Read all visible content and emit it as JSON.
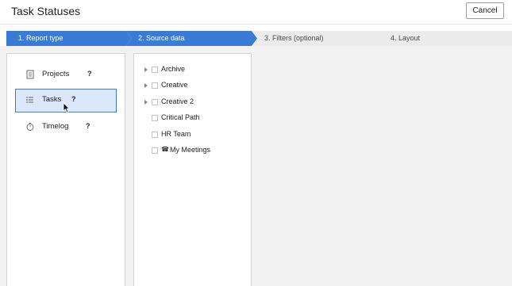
{
  "header": {
    "title": "Task Statuses",
    "cancel_label": "Cancel"
  },
  "steps": [
    {
      "label": "1. Report type",
      "state": "active"
    },
    {
      "label": "2. Source data",
      "state": "active"
    },
    {
      "label": "3. Filters (optional)",
      "state": "inactive"
    },
    {
      "label": "4. Layout",
      "state": "inactive"
    }
  ],
  "report_types": [
    {
      "label": "Projects",
      "help": "?",
      "icon": "document-list-icon",
      "selected": false
    },
    {
      "label": "Tasks",
      "help": "?",
      "icon": "list-icon",
      "selected": true
    },
    {
      "label": "Timelog",
      "help": "?",
      "icon": "stopwatch-icon",
      "selected": false
    }
  ],
  "source_tree": [
    {
      "label": "Archive",
      "expandable": true,
      "checked": false
    },
    {
      "label": "Creative",
      "expandable": true,
      "checked": false
    },
    {
      "label": "Creative 2",
      "expandable": true,
      "checked": false
    },
    {
      "label": "Critical Path",
      "expandable": false,
      "checked": false
    },
    {
      "label": "HR Team",
      "expandable": false,
      "checked": false
    },
    {
      "label": "My Meetings",
      "expandable": false,
      "checked": false,
      "icon": "phone-icon",
      "icon_glyph": "☎"
    }
  ],
  "colors": {
    "accent": "#3a7bd5",
    "selected_bg": "#dbe7fb",
    "inactive_step": "#ebebeb",
    "background": "#f2f2f2"
  }
}
